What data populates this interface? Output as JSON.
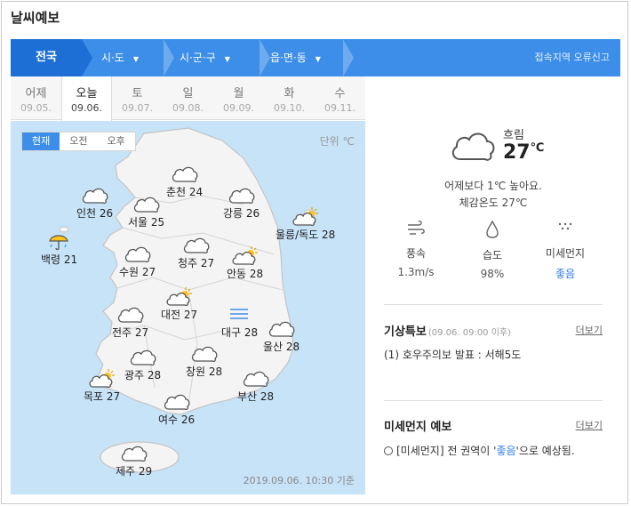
{
  "title": "날씨예보",
  "nav": {
    "items": [
      "전국",
      "시·도",
      "시·군·구",
      "읍·면·동"
    ],
    "report": "접속지역 오류신고"
  },
  "tabs": [
    {
      "day": "어제",
      "date": "09.05."
    },
    {
      "day": "오늘",
      "date": "09.06."
    },
    {
      "day": "토",
      "date": "09.07."
    },
    {
      "day": "일",
      "date": "09.08."
    },
    {
      "day": "월",
      "date": "09.09."
    },
    {
      "day": "화",
      "date": "09.10."
    },
    {
      "day": "수",
      "date": "09.11."
    }
  ],
  "map": {
    "segments": [
      "현재",
      "오전",
      "오후"
    ],
    "unit": "단위 ℃",
    "basis": "2019.09.06. 10:30 기준",
    "cities": [
      {
        "name": "춘천",
        "temp": "24",
        "icon": "cloud-icon"
      },
      {
        "name": "인천",
        "temp": "26",
        "icon": "cloud-icon"
      },
      {
        "name": "서울",
        "temp": "25",
        "icon": "cloud-icon"
      },
      {
        "name": "강릉",
        "temp": "26",
        "icon": "cloud-icon"
      },
      {
        "name": "울릉/독도",
        "temp": "28",
        "icon": "partly-cloudy-icon"
      },
      {
        "name": "백령",
        "temp": "21",
        "icon": "rain-umbrella-icon"
      },
      {
        "name": "청주",
        "temp": "27",
        "icon": "cloud-icon"
      },
      {
        "name": "수원",
        "temp": "27",
        "icon": "cloud-icon"
      },
      {
        "name": "안동",
        "temp": "28",
        "icon": "partly-cloudy-icon"
      },
      {
        "name": "대전",
        "temp": "27",
        "icon": "partly-cloudy-icon"
      },
      {
        "name": "대구",
        "temp": "28",
        "icon": "haze-icon"
      },
      {
        "name": "전주",
        "temp": "27",
        "icon": "cloud-icon"
      },
      {
        "name": "울산",
        "temp": "28",
        "icon": "cloud-icon"
      },
      {
        "name": "광주",
        "temp": "28",
        "icon": "cloud-icon"
      },
      {
        "name": "창원",
        "temp": "28",
        "icon": "cloud-icon"
      },
      {
        "name": "목포",
        "temp": "27",
        "icon": "partly-cloudy-icon"
      },
      {
        "name": "부산",
        "temp": "28",
        "icon": "cloud-icon"
      },
      {
        "name": "여수",
        "temp": "26",
        "icon": "cloud-icon"
      },
      {
        "name": "제주",
        "temp": "29",
        "icon": "cloud-icon"
      }
    ]
  },
  "current": {
    "desc": "흐림",
    "temp": "27",
    "unit": "℃",
    "compare": "어제보다 1℃ 높아요.",
    "feels": "체감온도 27℃",
    "stats": [
      {
        "label": "풍속",
        "value": "1.3m/s",
        "icon": "wind-icon"
      },
      {
        "label": "습도",
        "value": "98%",
        "icon": "humidity-drop-icon"
      },
      {
        "label": "미세먼지",
        "value": "좋음",
        "icon": "fine-dust-icon"
      }
    ]
  },
  "special": {
    "title": "기상특보",
    "time": "(09.06. 09:00 이후)",
    "more": "더보기",
    "text": "(1) 호우주의보 발표 : 서해5도"
  },
  "dust": {
    "title": "미세먼지 예보",
    "more": "더보기",
    "pre": "[미세먼지] 전 권역이 '",
    "level": "좋음",
    "post": "'으로 예상됨."
  }
}
